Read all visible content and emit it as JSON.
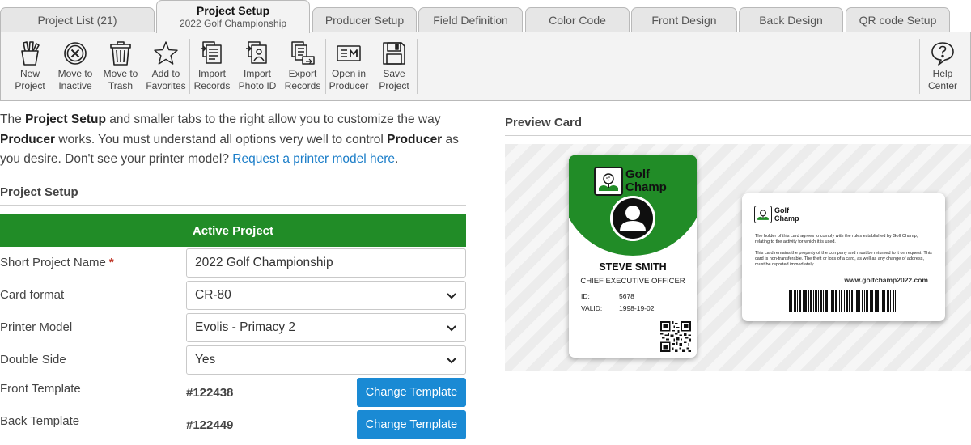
{
  "tabs": [
    {
      "label": "Project List (21)"
    },
    {
      "label": "Project Setup",
      "sublabel": "2022 Golf Championship"
    },
    {
      "label": "Producer Setup"
    },
    {
      "label": "Field Definition"
    },
    {
      "label": "Color Code"
    },
    {
      "label": "Front Design"
    },
    {
      "label": "Back Design"
    },
    {
      "label": "QR code Setup"
    }
  ],
  "toolbar": {
    "new_project": "New\nProject",
    "move_inactive": "Move to\nInactive",
    "move_trash": "Move to\nTrash",
    "add_favorites": "Add to\nFavorites",
    "import_records": "Import\nRecords",
    "import_photo": "Import\nPhoto ID",
    "export_records": "Export\nRecords",
    "open_producer": "Open in\nProducer",
    "save_project": "Save\nProject",
    "help_center": "Help\nCenter"
  },
  "intro": {
    "p1": "The ",
    "b1": "Project Setup",
    "p2": " and smaller tabs to the right allow you to customize the way ",
    "b2": "Producer",
    "p3": " works. You must understand all options very well to control ",
    "b3": "Producer",
    "p4": " as you desire. Don't see your printer model? ",
    "link": "Request a printer model here",
    "p5": "."
  },
  "setup": {
    "section_title": "Project Setup",
    "active_label": "Active Project",
    "short_name_label": "Short Project Name",
    "required_mark": "*",
    "short_name_value": "2022 Golf Championship",
    "card_format_label": "Card format",
    "card_format_value": "CR-80",
    "printer_label": "Printer Model",
    "printer_value": "Evolis - Primacy 2",
    "double_side_label": "Double Side",
    "double_side_value": "Yes",
    "front_template_label": "Front Template",
    "front_template_value": "#122438",
    "back_template_label": "Back Template",
    "back_template_value": "#122449",
    "change_template_label": "Change Template"
  },
  "preview": {
    "title": "Preview Card",
    "brand_line1": "Golf",
    "brand_line2": "Champ",
    "name": "STEVE SMITH",
    "job_title": "CHIEF EXECUTIVE OFFICER",
    "id_label": "ID:",
    "id_value": "5678",
    "valid_label": "VALID:",
    "valid_value": "1998-19-02",
    "back_text1": "The holder of this card agrees to comply with the rules established by Golf Champ, relating to the activity for which it is used.",
    "back_text2": "This card remains the property of the company and must be returned to it on request. This card is non-transferable. The theft or loss of a card, as well as any change of address, must be reported immediately.",
    "back_url": "www.golfchamp2022.com"
  },
  "colors": {
    "brand_green": "#218c27",
    "button_blue": "#1a8ad4",
    "link_blue": "#1a7dc8"
  }
}
